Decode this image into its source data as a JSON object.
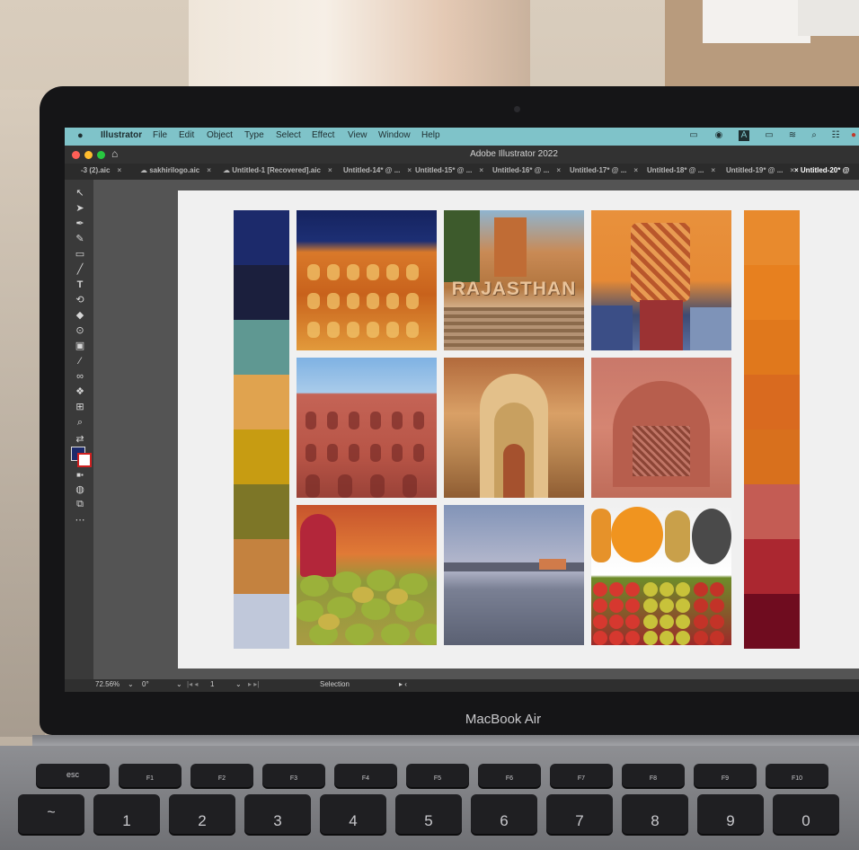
{
  "menubar": {
    "app_name": "Illustrator",
    "items": [
      "File",
      "Edit",
      "Object",
      "Type",
      "Select",
      "Effect",
      "View",
      "Window",
      "Help"
    ]
  },
  "window": {
    "title": "Adobe Illustrator 2022"
  },
  "tabs": [
    {
      "label": "-3 (2).aic"
    },
    {
      "label": "sakhirilogo.aic"
    },
    {
      "label": "Untitled-1 [Recovered].aic"
    },
    {
      "label": "Untitled-14* @ ..."
    },
    {
      "label": "Untitled-15* @ ..."
    },
    {
      "label": "Untitled-16* @ ..."
    },
    {
      "label": "Untitled-17* @ ..."
    },
    {
      "label": "Untitled-18* @ ..."
    },
    {
      "label": "Untitled-19* @ ..."
    },
    {
      "label": "Untitled-20* @"
    }
  ],
  "tab_close_glyph": "×",
  "tools": [
    "selection-tool",
    "direct-selection-tool",
    "pen-tool",
    "curvature-tool",
    "rectangle-tool",
    "paintbrush-tool",
    "type-tool",
    "rotate-tool",
    "eraser-tool",
    "lasso-tool",
    "gradient-tool",
    "eyedropper-tool",
    "blend-tool",
    "symbol-sprayer-tool",
    "artboard-tool",
    "zoom-tool"
  ],
  "statusbar": {
    "zoom": "72.56%",
    "rotation": "0°",
    "artboard": "1",
    "tool": "Selection"
  },
  "swatches_left": [
    "#1c2a6b",
    "#1b1f3d",
    "#5f9892",
    "#e0a34f",
    "#c79c12",
    "#7d7627",
    "#c4823f",
    "#c0c8da"
  ],
  "swatches_right": [
    "#e88a2d",
    "#e7801f",
    "#e0781c",
    "#d96a1f",
    "#d8701d",
    "#c45c54",
    "#ab2730",
    "#6f0c1f"
  ],
  "photos": [
    "hawa-mahal-facade",
    "rajasthan-sign-steps",
    "embroidered-bags",
    "pink-palace-facade",
    "ornate-archway",
    "carved-pink-window",
    "mango-vendor",
    "lake-palace-dusk",
    "fruit-display"
  ],
  "photo_text": {
    "rajasthan": "RAJASTHAN"
  },
  "laptop": {
    "model_label": "MacBook Air"
  },
  "keyboard": {
    "fn_row": [
      "esc",
      "F1",
      "F2",
      "F3",
      "F4",
      "F5",
      "F6",
      "F7",
      "F8",
      "F9",
      "F10"
    ],
    "num_row": [
      "~",
      "1",
      "2",
      "3",
      "4",
      "5",
      "6",
      "7",
      "8",
      "9",
      "0",
      "-"
    ]
  },
  "colors": {
    "menubar": "#7fc3c9",
    "ui_dark": "#323232",
    "canvas": "#545454"
  }
}
